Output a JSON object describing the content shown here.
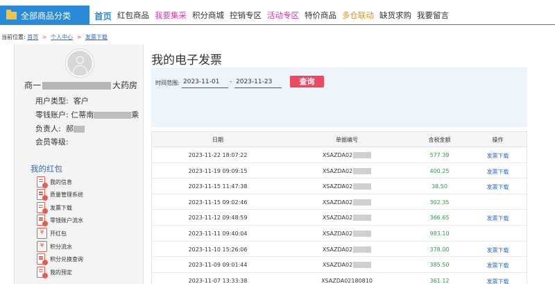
{
  "nav": {
    "all_categories": "全部商品分类",
    "items": [
      {
        "label": "首页",
        "color": "#2b8ad8"
      },
      {
        "label": "红包商品",
        "color": "#333333"
      },
      {
        "label": "我要集采",
        "color": "#d63fb0"
      },
      {
        "label": "积分商城",
        "color": "#333333"
      },
      {
        "label": "控销专区",
        "color": "#333333"
      },
      {
        "label": "活动专区",
        "color": "#d63fb0"
      },
      {
        "label": "特价商品",
        "color": "#333333"
      },
      {
        "label": "多仓联动",
        "color": "#e6921e"
      },
      {
        "label": "缺货求购",
        "color": "#333333"
      },
      {
        "label": "我要留言",
        "color": "#333333"
      }
    ]
  },
  "breadcrumb": {
    "prefix": "当前位置:",
    "home": "首页",
    "sep": ">",
    "center": "个人中心",
    "current": "发票下载"
  },
  "profile": {
    "name_start": "商一",
    "name_end": "大药房",
    "user_type_label": "用户类型:",
    "user_type_value": "客户",
    "account_label": "零钱账户:",
    "account_value_start": "仁蒂南",
    "account_value_end": "乘",
    "manager_label": "负责人:",
    "manager_value": "郝",
    "level_label": "会员等级:"
  },
  "menu": {
    "title": "我的红包",
    "items": [
      {
        "label": "我的信息",
        "icon": "document-icon"
      },
      {
        "label": "质量管理系统",
        "icon": "document-icon"
      },
      {
        "label": "发票下载",
        "icon": "document-icon"
      },
      {
        "label": "零钱账户流水",
        "icon": "document-icon"
      },
      {
        "label": "开红包",
        "icon": "yen-icon"
      },
      {
        "label": "积分流水",
        "icon": "yen-icon"
      },
      {
        "label": "积分兑换查询",
        "icon": "document-icon"
      },
      {
        "label": "我的预定",
        "icon": "document-icon"
      }
    ]
  },
  "main": {
    "title": "我的电子发票",
    "date_range_label": "时间范围:",
    "date_from": "2023-11-01",
    "date_to": "2023-11-23",
    "date_dash": "-",
    "query_label": "查询"
  },
  "table": {
    "headers": [
      "日期",
      "单据编号",
      "含税金额",
      "操作"
    ],
    "rows": [
      {
        "date": "2023-11-22 18:07:22",
        "no": "XSAZDA02",
        "amount": "577.39",
        "op": "发票下载"
      },
      {
        "date": "2023-11-19 09:09:15",
        "no": "XSAZDA02",
        "amount": "400.25",
        "op": "发票下载"
      },
      {
        "date": "2023-11-15 11:47:38",
        "no": "XSAZDA02",
        "amount": "38.50",
        "op": "发票下载"
      },
      {
        "date": "2023-11-15 09:02:46",
        "no": "XSAZDA02",
        "amount": "302.35",
        "op": ""
      },
      {
        "date": "2023-11-12 09:48:59",
        "no": "XSAZDA02",
        "amount": "366.65",
        "op": "发票下载"
      },
      {
        "date": "2023-11-11 09:40:04",
        "no": "XSAZDA02",
        "amount": "983.10",
        "op": ""
      },
      {
        "date": "2023-11-10 15:26:06",
        "no": "XSAZDA02",
        "amount": "378.00",
        "op": "发票下载"
      },
      {
        "date": "2023-11-09 09:01:44",
        "no": "XSAZDA02",
        "amount": "385.50",
        "op": "发票下载"
      },
      {
        "date": "2023-11-07 13:33:38",
        "no": "XSAZDA02180810",
        "amount": "361.12",
        "op": "发票下载"
      }
    ]
  }
}
